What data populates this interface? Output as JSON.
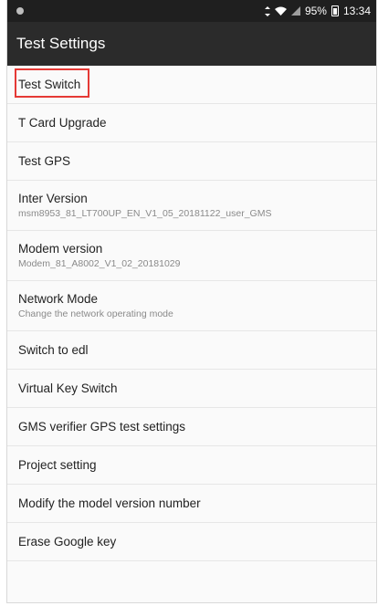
{
  "status_bar": {
    "time": "13:34",
    "battery": "95%",
    "icons": [
      "notification-dot-icon",
      "data-arrows-icon",
      "wifi-icon",
      "signal-icon",
      "battery-icon"
    ]
  },
  "app_bar": {
    "title": "Test Settings"
  },
  "settings": [
    {
      "title": "Test Switch",
      "summary": ""
    },
    {
      "title": "T Card Upgrade",
      "summary": ""
    },
    {
      "title": "Test GPS",
      "summary": ""
    },
    {
      "title": "Inter Version",
      "summary": "msm8953_81_LT700UP_EN_V1_05_20181122_user_GMS"
    },
    {
      "title": "Modem version",
      "summary": "Modem_81_A8002_V1_02_20181029"
    },
    {
      "title": "Network Mode",
      "summary": "Change the network operating mode"
    },
    {
      "title": "Switch to edl",
      "summary": ""
    },
    {
      "title": "Virtual Key Switch",
      "summary": ""
    },
    {
      "title": "GMS verifier GPS test settings",
      "summary": ""
    },
    {
      "title": "Project setting",
      "summary": ""
    },
    {
      "title": "Modify the model version number",
      "summary": ""
    },
    {
      "title": "Erase Google key",
      "summary": ""
    }
  ],
  "colors": {
    "highlight": "#e53935",
    "status_bar": "#1f1f1f",
    "app_bar": "#2b2b2b"
  }
}
